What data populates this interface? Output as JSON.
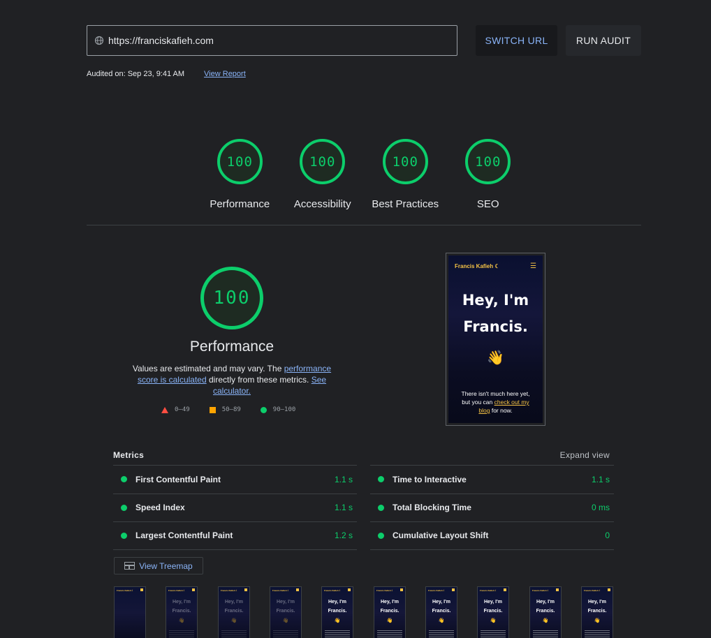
{
  "header": {
    "url": "https://franciskafieh.com",
    "switch_url_label": "SWITCH URL",
    "run_audit_label": "RUN AUDIT",
    "audited_on": "Audited on: Sep 23, 9:41 AM",
    "view_report_label": "View Report"
  },
  "categories": [
    {
      "score": "100",
      "label": "Performance"
    },
    {
      "score": "100",
      "label": "Accessibility"
    },
    {
      "score": "100",
      "label": "Best Practices"
    },
    {
      "score": "100",
      "label": "SEO"
    }
  ],
  "performance": {
    "score": "100",
    "title": "Performance",
    "desc_prefix": "Values are estimated and may vary. The ",
    "desc_link1": "performance score is calculated",
    "desc_middle": " directly from these metrics. ",
    "desc_link2": "See calculator.",
    "legend": [
      {
        "range": "0–49",
        "color": "#ff4e42",
        "shape": "triangle"
      },
      {
        "range": "50–89",
        "color": "#ffa400",
        "shape": "square"
      },
      {
        "range": "90–100",
        "color": "#0cce6b",
        "shape": "circle"
      }
    ]
  },
  "final_screenshot": {
    "brand": "Francis Kafieh ☾",
    "menu_icon": "hamburger-icon",
    "hero_line1": "Hey, I'm",
    "hero_line2": "Francis.",
    "wave": "👋",
    "text_prefix": "There isn't much here yet, but you can ",
    "text_link": "check out my blog",
    "text_suffix": " for now."
  },
  "metrics": {
    "title": "Metrics",
    "expand_label": "Expand view",
    "left": [
      {
        "label": "First Contentful Paint",
        "value": "1.1 s"
      },
      {
        "label": "Speed Index",
        "value": "1.1 s"
      },
      {
        "label": "Largest Contentful Paint",
        "value": "1.2 s"
      }
    ],
    "right": [
      {
        "label": "Time to Interactive",
        "value": "1.1 s"
      },
      {
        "label": "Total Blocking Time",
        "value": "0 ms"
      },
      {
        "label": "Cumulative Layout Shift",
        "value": "0"
      }
    ]
  },
  "treemap": {
    "label": "View Treemap",
    "icon": "treemap-icon"
  },
  "filmstrip": {
    "frames": [
      {
        "content": false
      },
      {
        "content": true,
        "faded": true
      },
      {
        "content": true,
        "faded": true
      },
      {
        "content": true,
        "faded": true
      },
      {
        "content": true
      },
      {
        "content": true
      },
      {
        "content": true
      },
      {
        "content": true
      },
      {
        "content": true
      },
      {
        "content": true
      }
    ],
    "frame_brand": "Francis Kafieh ☾",
    "frame_hero_line1": "Hey, I'm",
    "frame_hero_line2": "Francis.",
    "frame_wave": "👋"
  },
  "colors": {
    "pass": "#0cce6b",
    "average": "#ffa400",
    "fail": "#ff4e42",
    "link": "#8ab4f8",
    "background": "#202124"
  }
}
